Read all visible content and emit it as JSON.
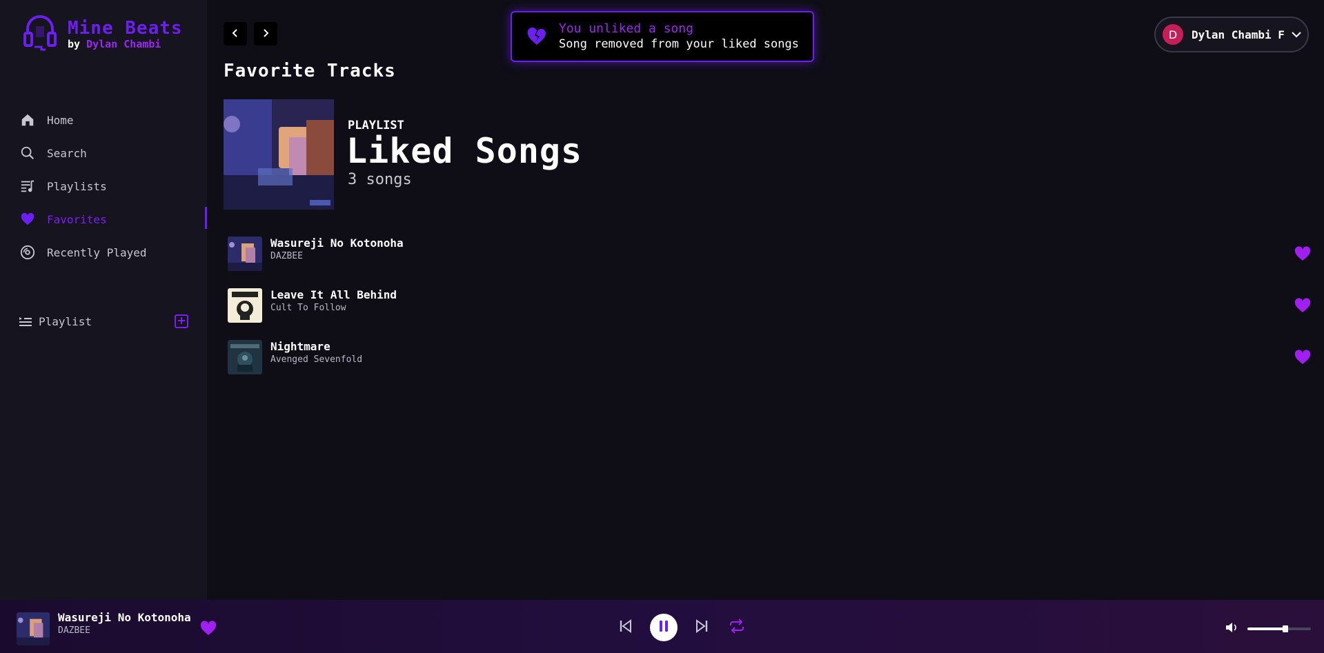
{
  "app": {
    "name": "Mine Beats",
    "by_prefix": "by",
    "author": "Dylan Chambi"
  },
  "colors": {
    "accent": "#6d1ef0",
    "accent_pink": "#9b27f0",
    "background": "#0f0e17",
    "sidebar": "#15141f",
    "heart": "#a21ff2"
  },
  "sidebar": {
    "items": [
      {
        "label": "Home",
        "icon": "home-icon",
        "active": false
      },
      {
        "label": "Search",
        "icon": "search-icon",
        "active": false
      },
      {
        "label": "Playlists",
        "icon": "playlist-icon",
        "active": false
      },
      {
        "label": "Favorites",
        "icon": "heart-icon",
        "active": true
      },
      {
        "label": "Recently Played",
        "icon": "disc-icon",
        "active": false
      }
    ],
    "playlist_section": {
      "label": "Playlist",
      "icon": "playlist-list-icon",
      "add_icon": "plus-square-icon"
    }
  },
  "header": {
    "back_icon": "chevron-left-icon",
    "forward_icon": "chevron-right-icon",
    "section_title": "Favorite Tracks"
  },
  "toast": {
    "icon": "broken-heart-icon",
    "title": "You unliked a song",
    "message": "Song removed from your liked songs"
  },
  "user": {
    "initial": "D",
    "name": "Dylan Chambi F",
    "chevron": "chevron-down-icon"
  },
  "playlist": {
    "type": "PLAYLIST",
    "title": "Liked Songs",
    "count": "3 songs"
  },
  "tracks": [
    {
      "title": "Wasureji No Kotonoha",
      "artist": "DAZBEE",
      "liked": true
    },
    {
      "title": "Leave It All Behind",
      "artist": "Cult To Follow",
      "liked": true
    },
    {
      "title": "Nightmare",
      "artist": "Avenged Sevenfold",
      "liked": true
    }
  ],
  "player": {
    "title": "Wasureji No Kotonoha",
    "artist": "DAZBEE",
    "liked": true,
    "state": "playing",
    "volume": 0.6
  }
}
